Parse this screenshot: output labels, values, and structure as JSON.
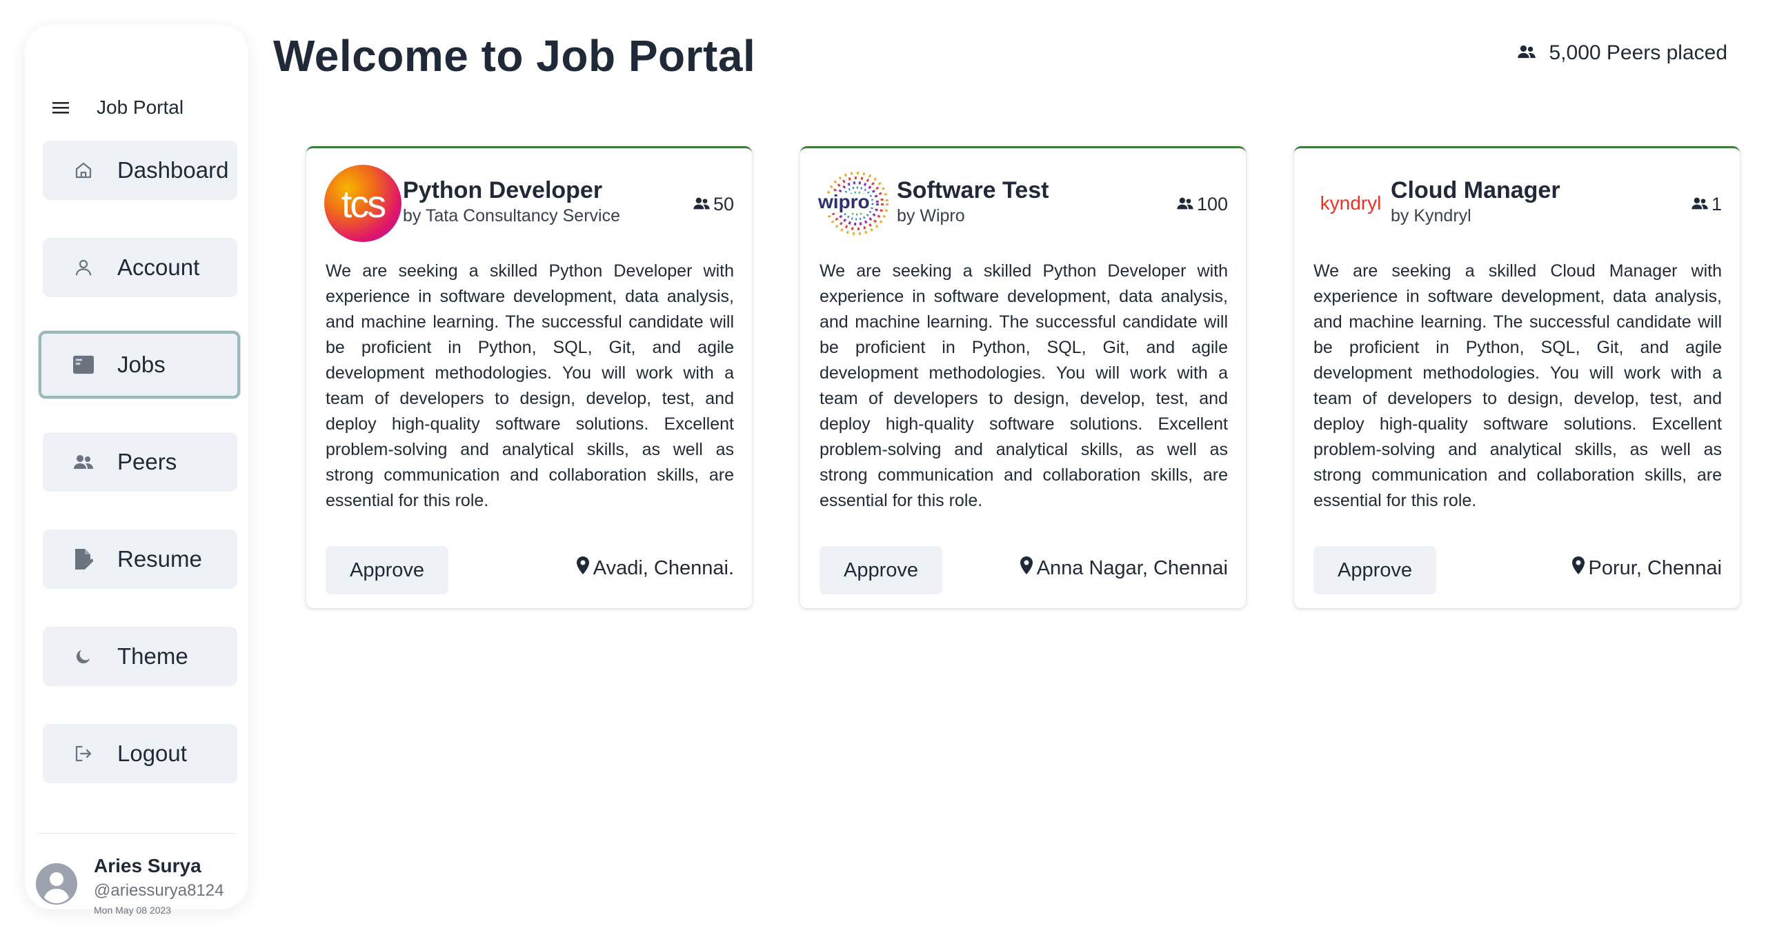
{
  "sidebar": {
    "title": "Job Portal",
    "items": [
      {
        "label": "Dashboard",
        "icon": "home-icon"
      },
      {
        "label": "Account",
        "icon": "user-icon"
      },
      {
        "label": "Jobs",
        "icon": "jobs-card-icon",
        "active": true
      },
      {
        "label": "Peers",
        "icon": "people-icon"
      },
      {
        "label": "Resume",
        "icon": "resume-edit-icon"
      },
      {
        "label": "Theme",
        "icon": "moon-icon"
      },
      {
        "label": "Logout",
        "icon": "logout-icon"
      }
    ],
    "user": {
      "name": "Aries Surya",
      "handle": "@ariessurya8124",
      "date": "Mon May 08 2023"
    }
  },
  "header": {
    "title": "Welcome to Job Portal",
    "placed": "5,000 Peers placed"
  },
  "jobs": [
    {
      "title": "Python Developer",
      "company": "by Tata Consultancy Service",
      "count": "50",
      "logo_text": "tcs",
      "description": "We are seeking a skilled Python Developer with experience in software development, data analysis, and machine learning. The successful candidate will be proficient in Python, SQL, Git, and agile development methodologies. You will work with a team of developers to design, develop, test, and deploy high-quality software solutions. Excellent problem-solving and analytical skills, as well as strong communication and collaboration skills, are essential for this role.",
      "approve_label": "Approve",
      "location": "Avadi, Chennai."
    },
    {
      "title": "Software Test",
      "company": "by Wipro",
      "count": "100",
      "logo_text": "wipro",
      "description": "We are seeking a skilled Python Developer with experience in software development, data analysis, and machine learning. The successful candidate will be proficient in Python, SQL, Git, and agile development methodologies. You will work with a team of developers to design, develop, test, and deploy high-quality software solutions. Excellent problem-solving and analytical skills, as well as strong communication and collaboration skills, are essential for this role.",
      "approve_label": "Approve",
      "location": "Anna Nagar, Chennai"
    },
    {
      "title": "Cloud Manager",
      "company": "by Kyndryl",
      "count": "1",
      "logo_text": "kyndryl",
      "description": "We are seeking a skilled Cloud Manager with experience in software development, data analysis, and machine learning. The successful candidate will be proficient in Python, SQL, Git, and agile development methodologies. You will work with a team of developers to design, develop, test, and deploy high-quality software solutions. Excellent problem-solving and analytical skills, as well as strong communication and collaboration skills, are essential for this role.",
      "approve_label": "Approve",
      "location": "Porur, Chennai"
    }
  ],
  "colors": {
    "card_top_border": "#3a7d3a",
    "nav_bg": "#eef1f5",
    "active_border": "#9bb9bc",
    "icon_gray": "#6b7280"
  }
}
